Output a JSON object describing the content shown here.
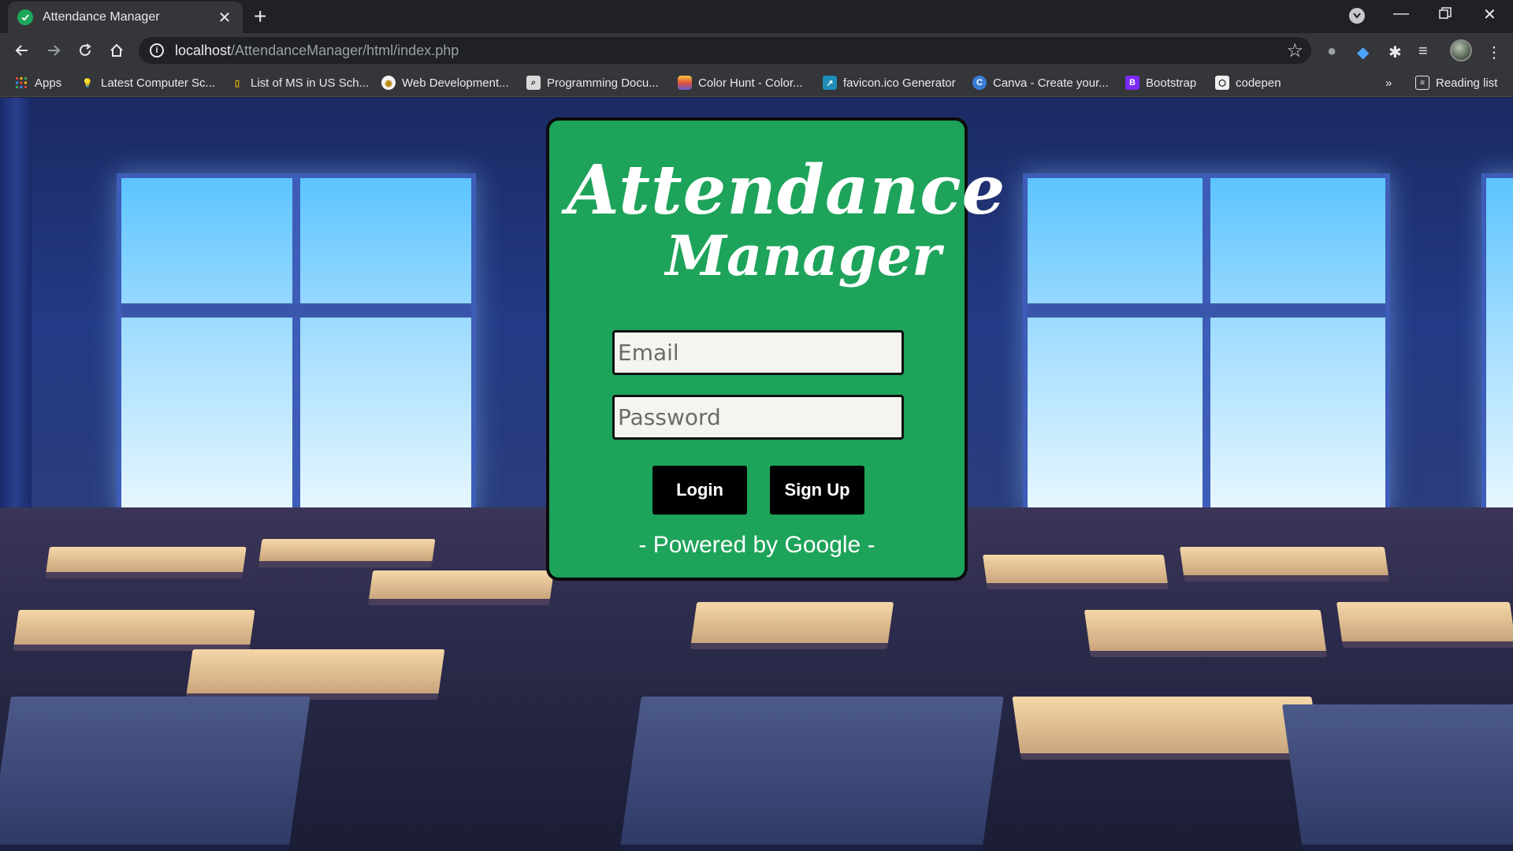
{
  "browser": {
    "tab_title": "Attendance Manager",
    "url_host": "localhost",
    "url_path": "/AttendanceManager/html/index.php",
    "bookmarks": [
      {
        "label": "Apps",
        "icon": "apps-grid-icon"
      },
      {
        "label": "Latest Computer Sc...",
        "icon": "bulb-icon"
      },
      {
        "label": "List of MS in US Sch...",
        "icon": "doc-icon"
      },
      {
        "label": "Web Development...",
        "icon": "web-dev-icon"
      },
      {
        "label": "Programming Docu...",
        "icon": "search-doc-icon"
      },
      {
        "label": "Color Hunt - Color...",
        "icon": "color-hunt-icon"
      },
      {
        "label": "favicon.ico Generator",
        "icon": "favicon-generator-icon"
      },
      {
        "label": "Canva - Create your...",
        "icon": "canva-icon"
      },
      {
        "label": "Bootstrap",
        "icon": "bootstrap-icon"
      },
      {
        "label": "codepen",
        "icon": "codepen-icon"
      }
    ],
    "reading_list": "Reading list",
    "more_bookmarks": "»"
  },
  "card": {
    "title_line1": "Attendance",
    "title_line2": "Manager",
    "email_placeholder": "Email",
    "password_placeholder": "Password",
    "login_label": "Login",
    "signup_label": "Sign Up",
    "powered_by": "- Powered by Google -"
  },
  "colors": {
    "card_green": "#1ea35a",
    "button_black": "#000000"
  }
}
